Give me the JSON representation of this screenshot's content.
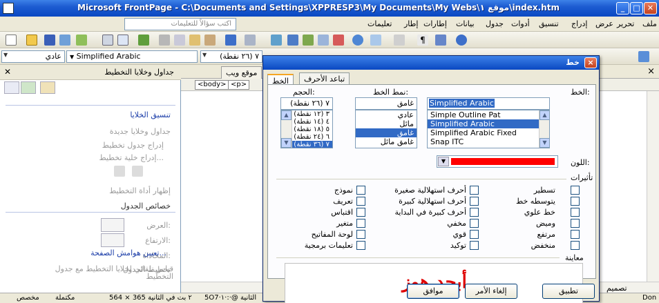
{
  "window": {
    "title": "Microsoft FrontPage - C:\\Documents and Settings\\XPPRESP3\\My Documents\\My Webs\\موقع ١\\index.htm"
  },
  "menu": {
    "help_placeholder": "اكتب سؤالاً للتعليمات",
    "items": [
      "ملف",
      "تحرير",
      "عرض",
      "إدراج",
      "تنسيق",
      "أدوات",
      "جدول",
      "بيانات",
      "إطارات",
      "إطار",
      "تعليمات"
    ]
  },
  "format_toolbar": {
    "style_value": "عادي",
    "font_value": "Simplified Arabic",
    "size_value": "(٢٦ نقطة) ٧"
  },
  "task_pane": {
    "title": "جداول وخلايا التخطيط",
    "cell_formatting_link": "تنسيق الخلايا",
    "new_tables_heading": "جداول وخلايا جديدة",
    "insert_layout_table": "إدراج جدول تخطيط",
    "insert_layout_cell": "إدراج خلية تخطيط...",
    "show_layout_tool": "إظهار أداة التخطيط",
    "table_properties_heading": "خصائص الجدول",
    "width_label": "العرض:",
    "height_label": "الارتفاع:",
    "alignment_label": "المحاذاة:",
    "autoscale_label": "قياس تلقائي لخلايا التخطيط مع جدول التخطيط",
    "set_margins_link": "تعيين هوامش الصفحة...",
    "table_layout_label": "تخطيط الجدول"
  },
  "doc": {
    "tab_site": "موقع ويب",
    "tag_body": "<body>",
    "tag_p": "<p>",
    "close_glyph": "×"
  },
  "status": {
    "position": "5O7·الثانية @·:·١",
    "time_text": "564 × 365  ٢ بت في الثانية",
    "complete": "مكتملة",
    "custom": "مخصص",
    "view_design": "تصميم",
    "done": "Don"
  },
  "font_dialog": {
    "title": "خط",
    "close_glyph": "×",
    "tabs": [
      "الخط",
      "تباعد الأحرف"
    ],
    "font_label": "الخط:",
    "font_value": "Simplified Arabic",
    "fonts": [
      "Simple Outline Pat",
      "Simplified Arabic",
      "Simplified Arabic Fixed",
      "Snap ITC"
    ],
    "selected_font": "Simplified Arabic",
    "style_label": "نمط الخط:",
    "style_value": "غامق",
    "styles": [
      "عادي",
      "مائل",
      "غامق",
      "غامق مائل"
    ],
    "selected_style": "غامق",
    "size_label": "الحجم:",
    "size_value": "(٢٦ نقطة) ٧",
    "sizes": [
      "(١٢ نقطة) ٣",
      "(١٤ نقطة) ٤",
      "(١٨ نقطة) ٥",
      "(٢٤ نقطة) ٦",
      "(٣٦ نقطة) ٧"
    ],
    "selected_size": "(٣٦ نقطة) ٧",
    "color_label": "اللون:",
    "color_value": "#ff0000",
    "effects_label": "تأثيرات",
    "effects_col1": [
      "تسطير",
      "يتوسطه خط",
      "خط علوي",
      "وميض",
      "مرتفع",
      "منخفض"
    ],
    "effects_col2": [
      "أحرف استهلالية صغيرة",
      "أحرف استهلالية كبيرة",
      "أحرف كبيرة في البداية",
      "مخفي",
      "قوي",
      "توكيد"
    ],
    "effects_col3": [
      "نموذج",
      "تعريف",
      "اقتباس",
      "متغير",
      "لوحة المفاتيح",
      "تعليمات برمجية"
    ],
    "preview_label": "معاينة",
    "preview_text": "أبجد هوز",
    "buttons": {
      "ok": "موافق",
      "cancel": "إلغاء الأمر",
      "apply": "تطبيق"
    }
  }
}
